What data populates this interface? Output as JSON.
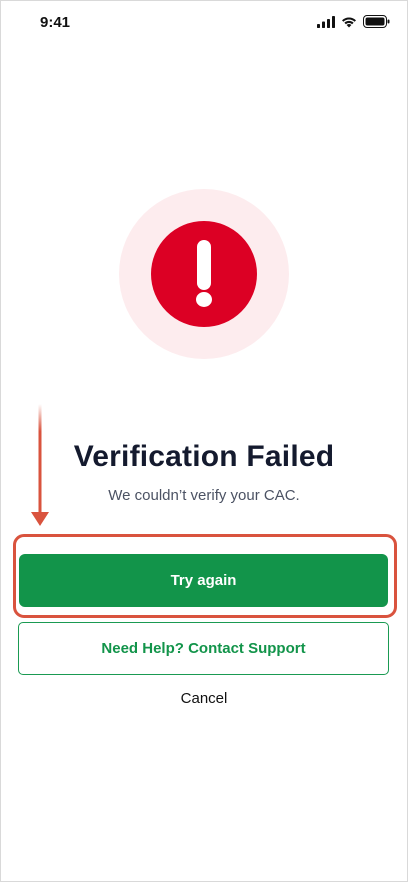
{
  "status_bar": {
    "time": "9:41",
    "icons": [
      "cellular-signal-icon",
      "wifi-icon",
      "battery-icon"
    ]
  },
  "error_icon": {
    "name": "exclamation-alert-icon",
    "circle_color": "#dc0024",
    "halo_color": "#fdecee"
  },
  "message": {
    "title": "Verification Failed",
    "subtitle": "We couldn’t verify your CAC."
  },
  "actions": {
    "primary_label": "Try again",
    "secondary_label": "Need Help? Contact Support",
    "cancel_label": "Cancel"
  },
  "colors": {
    "primary_green": "#12944a",
    "annotation_red": "#d9533e",
    "title_text": "#141a2e"
  }
}
